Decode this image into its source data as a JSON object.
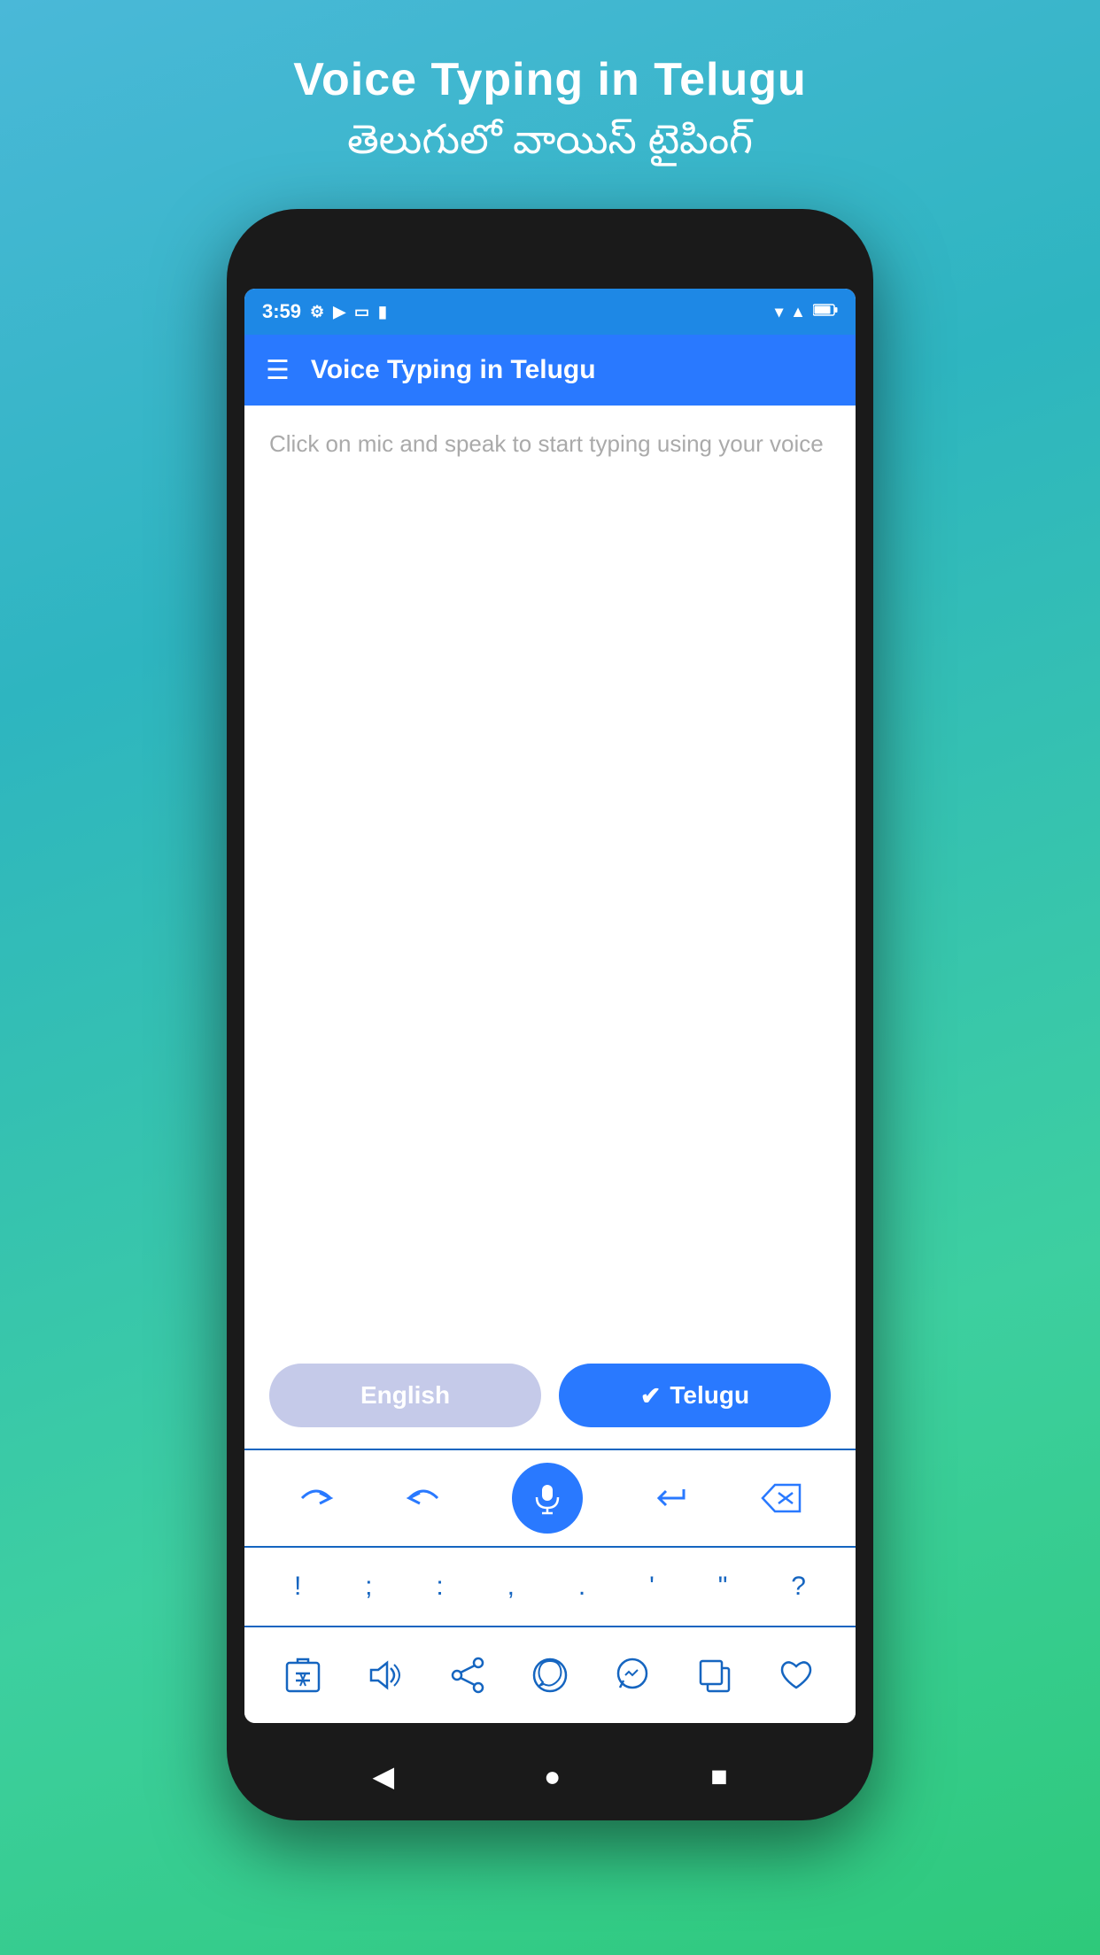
{
  "header": {
    "title_english": "Voice Typing in Telugu",
    "title_telugu": "తెలుగులో వాయిస్ టైపింగ్"
  },
  "status_bar": {
    "time": "3:59"
  },
  "app_bar": {
    "title": "Voice Typing in Telugu"
  },
  "text_area": {
    "placeholder": "Click on mic and speak to start typing using your voice"
  },
  "language_buttons": {
    "english_label": "English",
    "telugu_label": "Telugu"
  },
  "special_chars": {
    "chars": [
      "!",
      ";",
      ":",
      ",",
      ".",
      "'",
      "\"",
      "?"
    ]
  },
  "navigation": {
    "back": "◀",
    "home": "●",
    "recent": "■"
  }
}
